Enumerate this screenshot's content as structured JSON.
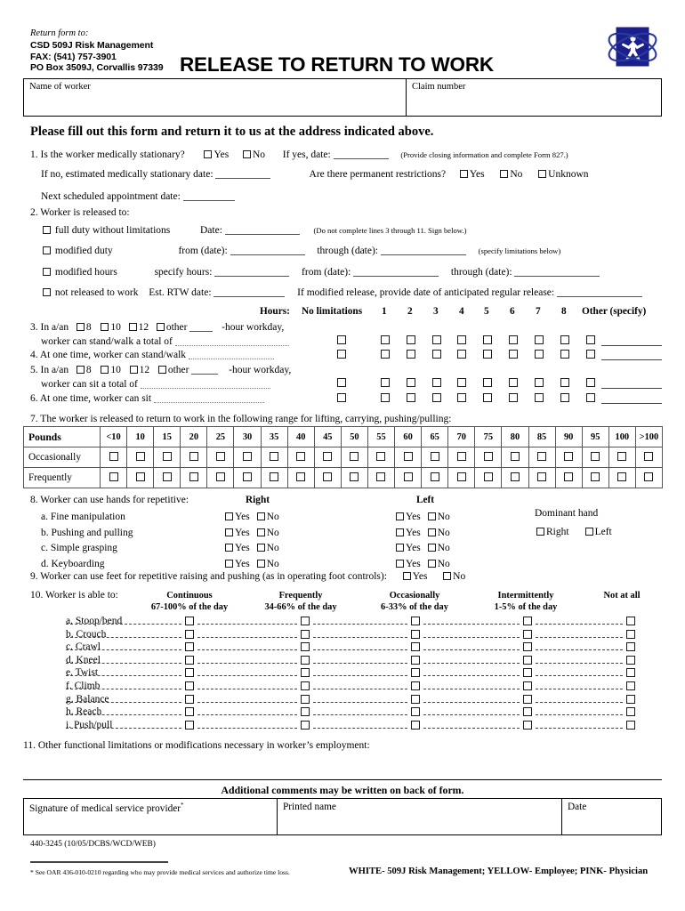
{
  "header": {
    "return_label": "Return form to:",
    "return_lines": [
      "CSD 509J Risk Management",
      "FAX:  (541) 757-3901",
      "PO Box 3509J, Corvallis  97339"
    ],
    "title": "RELEASE TO RETURN TO WORK",
    "logo_name": "sbh-figure-logo",
    "logo_color": "#1a1f8c"
  },
  "identity": {
    "name_label": "Name of worker",
    "claim_label": "Claim number"
  },
  "instruction": "Please fill out this form and return it to us at the address indicated above.",
  "q1": {
    "number": "1.",
    "question": "Is the worker medically stationary?",
    "yes": "Yes",
    "no": "No",
    "if_yes_date": "If yes, date:",
    "note": "(Provide closing information and complete Form 827.)",
    "if_no_label": "If no, estimated medically stationary date:",
    "perm_question": "Are there permanent restrictions?",
    "perm_yes": "Yes",
    "perm_no": "No",
    "perm_unknown": "Unknown",
    "next_appt_label": "Next scheduled appointment date:"
  },
  "q2": {
    "number": "2.",
    "heading": "Worker is released to:",
    "rows": [
      {
        "option": "full duty without limitations",
        "f1_label": "Date:",
        "note": "(Do not complete lines 3 through 11. Sign below.)"
      },
      {
        "option": "modified duty",
        "f1_label": "from (date):",
        "f2_label": "through (date):",
        "note": "(specify limitations below)"
      },
      {
        "option": "modified hours",
        "f1_label": "specify hours:",
        "f2_label": "from (date):",
        "f3_label": "through (date):"
      },
      {
        "option": "not released to work",
        "f1_label": "Est. RTW date:",
        "note": "If modified release, provide date of anticipated regular release:"
      }
    ]
  },
  "hours_grid": {
    "hours_label": "Hours:",
    "no_limitations": "No limitations",
    "numbers": [
      "1",
      "2",
      "3",
      "4",
      "5",
      "6",
      "7",
      "8"
    ],
    "other": "Other (specify)"
  },
  "q3": {
    "number": "3.",
    "prefix": "In a/an",
    "options": [
      "8",
      "10",
      "12",
      "other"
    ],
    "suffix": "-hour workday,",
    "line2": "worker can stand/walk a total of"
  },
  "q4": {
    "number": "4.",
    "text": "At one time, worker can stand/walk"
  },
  "q5": {
    "number": "5.",
    "prefix": "In a/an",
    "options": [
      "8",
      "10",
      "12",
      "other"
    ],
    "suffix": "-hour workday,",
    "line2": "worker can sit a total of"
  },
  "q6": {
    "number": "6.",
    "text": "At one time, worker can sit"
  },
  "q7": {
    "number": "7.",
    "text": "The worker is released to return to work in the following range for lifting, carrying, pushing/pulling:",
    "table": {
      "corner_header": "Pounds",
      "columns": [
        "<10",
        "10",
        "15",
        "20",
        "25",
        "30",
        "35",
        "40",
        "45",
        "50",
        "55",
        "60",
        "65",
        "70",
        "75",
        "80",
        "85",
        "90",
        "95",
        "100",
        ">100"
      ],
      "rows": [
        "Occasionally",
        "Frequently"
      ]
    }
  },
  "q8": {
    "number": "8.",
    "heading": "Worker can use hands for repetitive:",
    "col_right": "Right",
    "col_left": "Left",
    "yes": "Yes",
    "no": "No",
    "items": [
      "a. Fine manipulation",
      "b. Pushing and pulling",
      "c. Simple grasping",
      "d. Keyboarding"
    ],
    "dominant_label": "Dominant hand",
    "dominant_right": "Right",
    "dominant_left": "Left"
  },
  "q9": {
    "number": "9.",
    "text": "Worker can use feet for repetitive raising and pushing (as in operating foot controls):",
    "yes": "Yes",
    "no": "No"
  },
  "q10": {
    "number": "10.",
    "heading": "Worker is able to:",
    "columns": [
      {
        "title": "Continuous",
        "sub": "67-100% of the day"
      },
      {
        "title": "Frequently",
        "sub": "34-66% of the day"
      },
      {
        "title": "Occasionally",
        "sub": "6-33% of the day"
      },
      {
        "title": "Intermittently",
        "sub": "1-5% of the day"
      },
      {
        "title": "Not at all",
        "sub": ""
      }
    ],
    "items": [
      "a. Stoop/bend",
      "b. Crouch",
      "c. Crawl",
      "d. Kneel",
      "e. Twist",
      "f. Climb",
      "g. Balance",
      "h. Reach",
      "i. Push/pull"
    ]
  },
  "q11": {
    "number": "11.",
    "text": "Other functional limitations or modifications necessary in worker’s employment:"
  },
  "footer": {
    "additional_comments": "Additional comments may be written on back of form.",
    "sig_label": "Signature of medical service provider",
    "sig_asterisk": "*",
    "printed_name_label": "Printed name",
    "date_label": "Date",
    "form_number": "440-3245 (10/05/DCBS/WCD/WEB)",
    "footnote": "* See OAR 436-010-0210 regarding who may provide medical services and authorize time loss.",
    "distribution": "WHITE- 509J Risk Management; YELLOW- Employee; PINK- Physician"
  }
}
